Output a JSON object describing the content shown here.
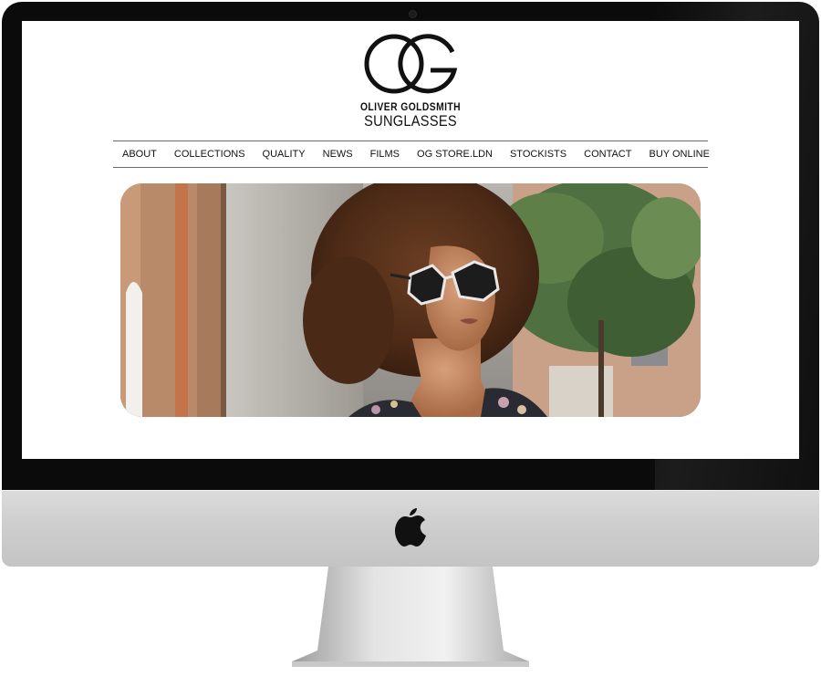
{
  "site": {
    "logo_monogram": "OG",
    "brand_name": "OLIVER GOLDSMITH",
    "brand_sub": "SUNGLASSES"
  },
  "nav": {
    "items": [
      {
        "label": "ABOUT"
      },
      {
        "label": "COLLECTIONS"
      },
      {
        "label": "QUALITY"
      },
      {
        "label": "NEWS"
      },
      {
        "label": "FILMS"
      },
      {
        "label": "OG STORE.LDN"
      },
      {
        "label": "STOCKISTS"
      },
      {
        "label": "CONTACT"
      },
      {
        "label": "BUY ONLINE"
      }
    ]
  },
  "hero": {
    "subject": "model-with-afro-wearing-sunglasses"
  },
  "device": {
    "logo_icon": "apple-icon",
    "bezel_color": "#0b0b0b",
    "chin_color": "#cfcfcf"
  }
}
